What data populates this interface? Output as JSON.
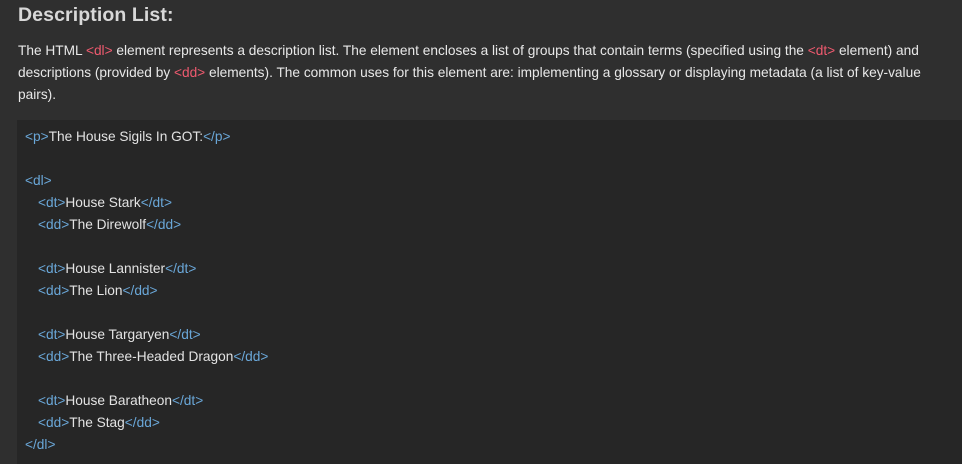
{
  "heading": "Description List:",
  "paragraph": {
    "part1": "The HTML ",
    "tag1": "<dl>",
    "part2": " element represents a description list. The element encloses a list of groups that contain terms (specified using the ",
    "tag2": "<dt>",
    "part3": " element) and descriptions (provided by ",
    "tag3": "<dd>",
    "part4": " elements). The common uses for this element are: implementing a glossary or displaying metadata (a list of key-value pairs)."
  },
  "code": {
    "p_open": "<",
    "p_tag": "p",
    "p_close": ">",
    "p_text": "The House Sigils In GOT:",
    "p_end_open": "</",
    "p_end_tag": "p",
    "p_end_close": ">",
    "dl_open": "<",
    "dl_tag": "dl",
    "dl_close": ">",
    "dl_end_open": "</",
    "dl_end_tag": "dl",
    "dl_end_close": ">",
    "dt_tag": "dt",
    "dd_tag": "dd",
    "entries": [
      {
        "dt": "House Stark",
        "dd": "The Direwolf"
      },
      {
        "dt": "House Lannister",
        "dd": "The Lion"
      },
      {
        "dt": "House Targaryen",
        "dd": "The Three-Headed Dragon"
      },
      {
        "dt": "House Baratheon",
        "dd": "The Stag"
      }
    ]
  },
  "colors": {
    "background": "#2f2f2f",
    "code_background": "#262626",
    "inline_tag": "#ef5a6f",
    "code_tag": "#6aa7d8",
    "text": "#e5e5e5"
  }
}
